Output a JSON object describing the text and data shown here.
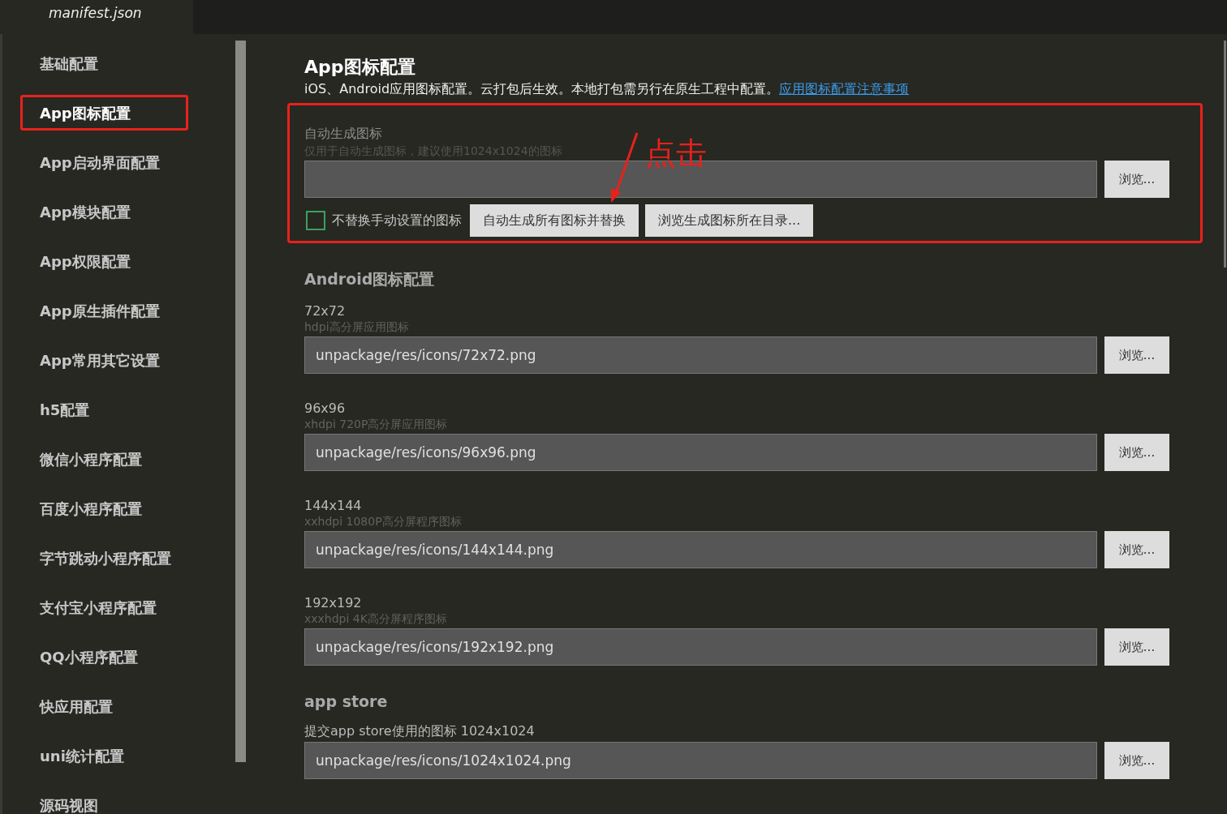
{
  "tab": {
    "title": "manifest.json"
  },
  "sidebar": {
    "items": [
      {
        "label": "基础配置",
        "selected": false
      },
      {
        "label": "App图标配置",
        "selected": true
      },
      {
        "label": "App启动界面配置",
        "selected": false
      },
      {
        "label": "App模块配置",
        "selected": false
      },
      {
        "label": "App权限配置",
        "selected": false
      },
      {
        "label": "App原生插件配置",
        "selected": false
      },
      {
        "label": "App常用其它设置",
        "selected": false
      },
      {
        "label": "h5配置",
        "selected": false
      },
      {
        "label": "微信小程序配置",
        "selected": false
      },
      {
        "label": "百度小程序配置",
        "selected": false
      },
      {
        "label": "字节跳动小程序配置",
        "selected": false
      },
      {
        "label": "支付宝小程序配置",
        "selected": false
      },
      {
        "label": "QQ小程序配置",
        "selected": false
      },
      {
        "label": "快应用配置",
        "selected": false
      },
      {
        "label": "uni统计配置",
        "selected": false
      },
      {
        "label": "源码视图",
        "selected": false
      }
    ]
  },
  "page": {
    "title": "App图标配置",
    "description": "iOS、Android应用图标配置。云打包后生效。本地打包需另行在原生工程中配置。",
    "link": "应用图标配置注意事项"
  },
  "auto_generate": {
    "label": "自动生成图标",
    "hint": "仅用于自动生成图标，建议使用1024x1024的图标",
    "browse_button": "浏览...",
    "checkbox": {
      "label": "不替换手动设置的图标",
      "checked": false
    },
    "buttons": [
      "自动生成所有图标并替换",
      "浏览生成图标所在目录..."
    ],
    "annotation": {
      "text": "点击"
    }
  },
  "android": {
    "heading": "Android图标配置",
    "icons": [
      {
        "label": "72x72",
        "hint": "hdpi高分屏应用图标",
        "value": "unpackage/res/icons/72x72.png",
        "browse_button": "浏览..."
      },
      {
        "label": "96x96",
        "hint": "xhdpi 720P高分屏应用图标",
        "value": "unpackage/res/icons/96x96.png",
        "browse_button": "浏览..."
      },
      {
        "label": "144x144",
        "hint": "xxhdpi 1080P高分屏程序图标",
        "value": "unpackage/res/icons/144x144.png",
        "browse_button": "浏览..."
      },
      {
        "label": "192x192",
        "hint": "xxxhdpi 4K高分屏程序图标",
        "value": "unpackage/res/icons/192x192.png",
        "browse_button": "浏览..."
      }
    ]
  },
  "app_store": {
    "heading": "app store",
    "label": "提交app store使用的图标 1024x1024",
    "value": "unpackage/res/icons/1024x1024.png",
    "browse_button": "浏览..."
  }
}
